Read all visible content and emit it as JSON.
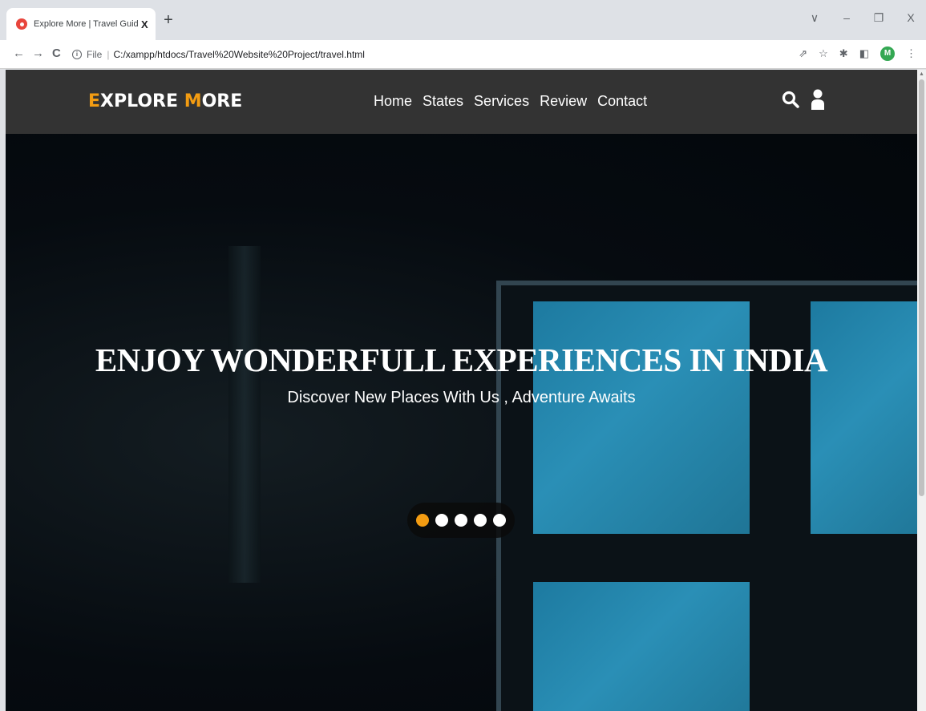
{
  "browser": {
    "tab": {
      "title": "Explore More | Travel Guide Web",
      "close": "X"
    },
    "newtab": "+",
    "window_controls": [
      "∨",
      "–",
      "❐",
      "X"
    ],
    "nav": {
      "back": "←",
      "forward": "→",
      "reload": "C"
    },
    "omnibox": {
      "info": "i",
      "scheme": "File",
      "separator": "|",
      "url": "C:/xampp/htdocs/Travel%20Website%20Project/travel.html"
    },
    "right_icons": {
      "share": "⇗",
      "star": "☆",
      "extensions": "✱",
      "sidepanel": "◧",
      "profile": "M",
      "menu": "⋮"
    }
  },
  "site": {
    "logo": {
      "first_letter": "E",
      "first_rest": "XPLORE ",
      "second_letter": "M",
      "second_rest": "ORE"
    },
    "nav": [
      "Home",
      "States",
      "Services",
      "Review",
      "Contact"
    ],
    "icons": [
      "search-icon",
      "user-icon"
    ],
    "accent_color": "#f39c12",
    "header_color": "#333333"
  },
  "hero": {
    "title": "ENJOY WONDERFULL EXPERIENCES IN INDIA",
    "subtitle": "Discover New Places With Us , Adventure Awaits",
    "slides": 5,
    "active_slide": 0
  }
}
